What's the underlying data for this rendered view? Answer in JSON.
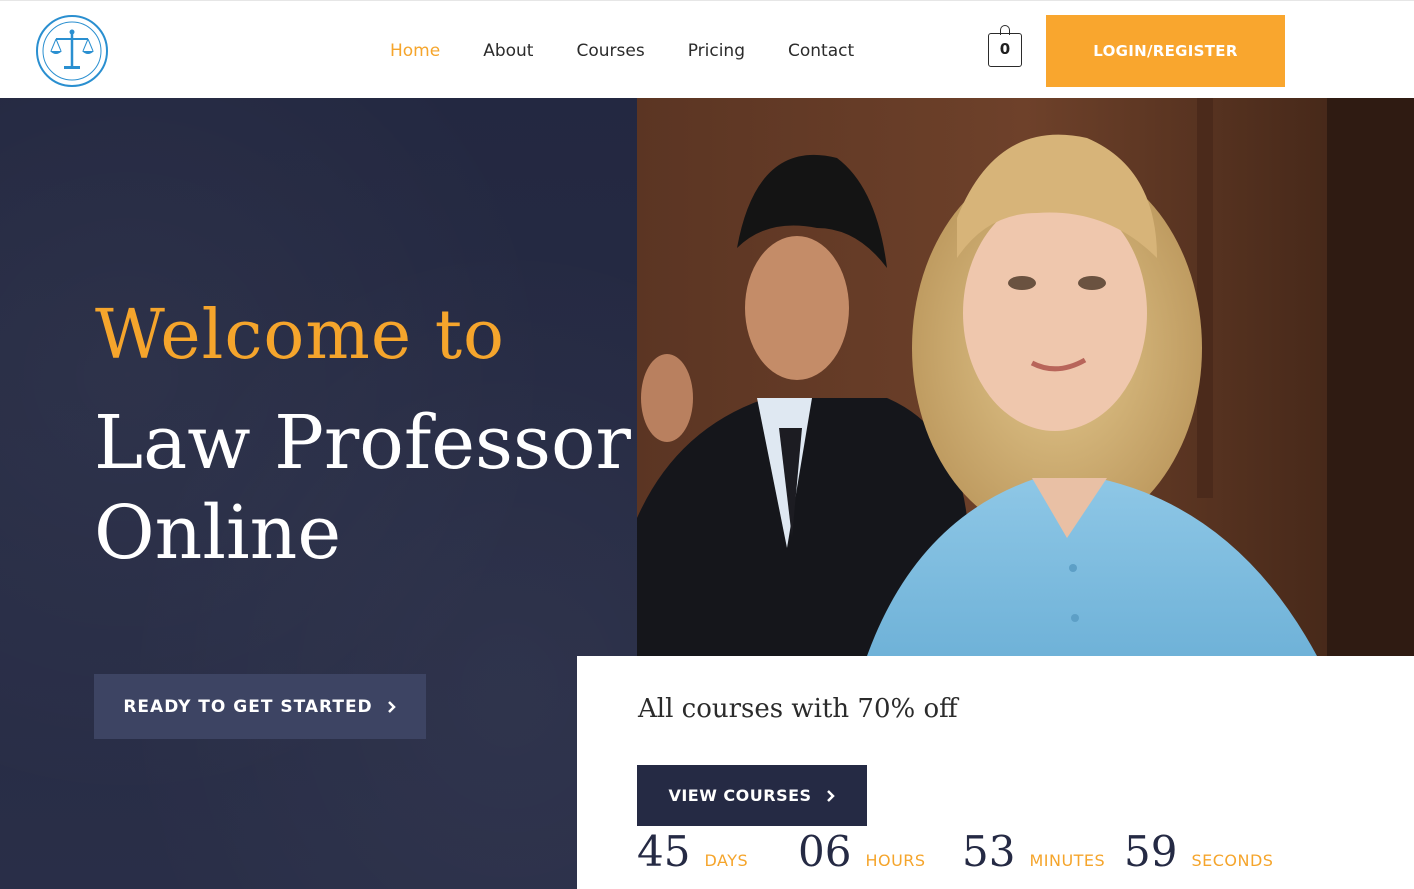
{
  "header": {
    "logo_alt": "Law Professor Online",
    "nav": [
      {
        "label": "Home",
        "active": true
      },
      {
        "label": "About",
        "active": false
      },
      {
        "label": "Courses",
        "active": false
      },
      {
        "label": "Pricing",
        "active": false
      },
      {
        "label": "Contact",
        "active": false
      }
    ],
    "cart_count": "0",
    "login_label": "LOGIN/REGISTER"
  },
  "hero": {
    "welcome": "Welcome to",
    "title_line1": "Law Professor",
    "title_line2": "Online",
    "cta_label": "READY TO GET STARTED",
    "cta_icon": "chevron-right-icon"
  },
  "offer": {
    "text": "All courses with 70% off",
    "button_label": "VIEW COURSES",
    "button_icon": "chevron-right-icon",
    "countdown": [
      {
        "value": "45",
        "unit": "DAYS"
      },
      {
        "value": "06",
        "unit": "HOURS"
      },
      {
        "value": "53",
        "unit": "MINUTES"
      },
      {
        "value": "59",
        "unit": "SECONDS"
      }
    ]
  },
  "colors": {
    "accent": "#f5a52c",
    "navy": "#252a44",
    "button_gray": "#3d4463",
    "logo_blue": "#2a8fd0"
  }
}
